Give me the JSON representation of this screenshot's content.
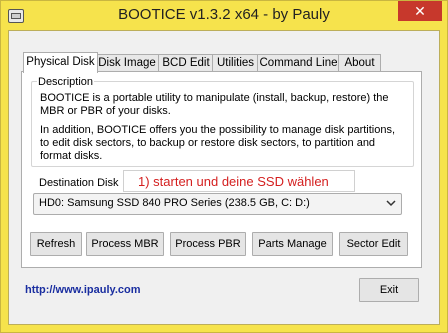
{
  "window": {
    "title": "BOOTICE v1.3.2 x64 - by Pauly",
    "close_glyph": "✕"
  },
  "tabs": [
    {
      "label": "Physical Disk",
      "active": true
    },
    {
      "label": "Disk Image",
      "active": false
    },
    {
      "label": "BCD Edit",
      "active": false
    },
    {
      "label": "Utilities",
      "active": false
    },
    {
      "label": "Command Line",
      "active": false
    },
    {
      "label": "About",
      "active": false
    }
  ],
  "description": {
    "legend": "Description",
    "line1": "BOOTICE is a portable utility to manipulate (install, backup, restore) the",
    "line2": "MBR or PBR of your disks.",
    "line3": "In addition, BOOTICE offers you the possibility to manage disk partitions,",
    "line4": "to edit disk sectors, to backup or restore disk sectors, to partition and",
    "line5": "format disks."
  },
  "destination": {
    "label": "Destination Disk",
    "selected": "HD0: Samsung SSD 840 PRO Series (238.5 GB, C: D:)"
  },
  "annotation": "1) starten und deine SSD wählen",
  "buttons": {
    "refresh": "Refresh",
    "process_mbr": "Process MBR",
    "process_pbr": "Process PBR",
    "parts_manage": "Parts Manage",
    "sector_edit": "Sector Edit",
    "exit": "Exit"
  },
  "footer_link": "http://www.ipauly.com",
  "colors": {
    "frame": "#f6e34c",
    "annotation_text": "#d41f1f",
    "close": "#c7382c",
    "link": "#1a2ea0"
  }
}
